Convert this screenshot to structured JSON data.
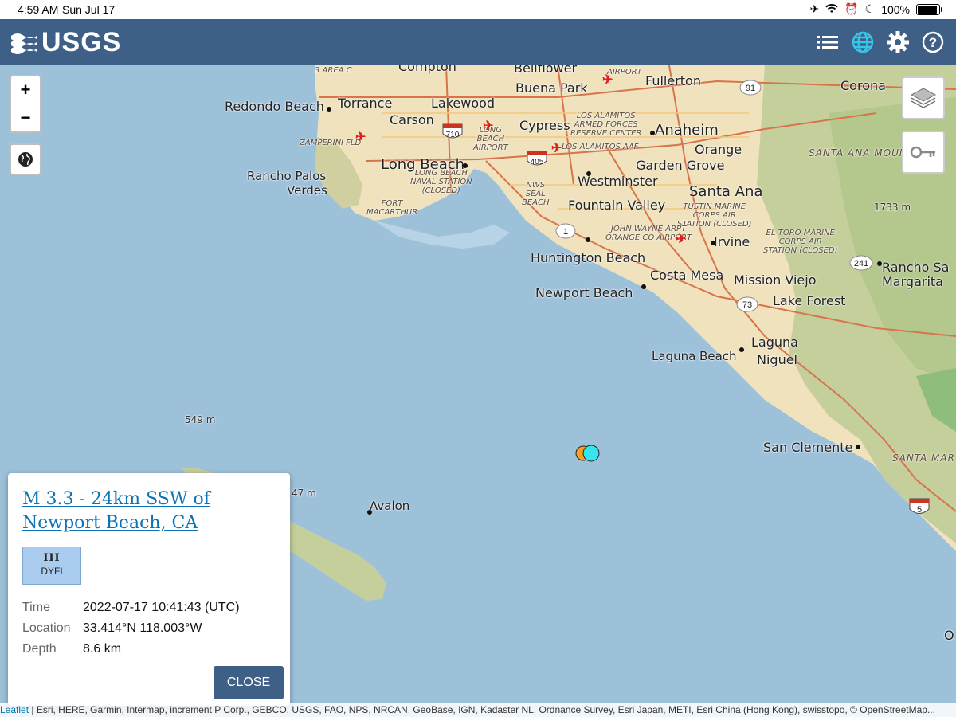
{
  "status_bar": {
    "time": "4:59 AM",
    "date": "Sun Jul 17",
    "battery": "100%",
    "battery_level": 1.0
  },
  "header": {
    "logo_text": "USGS",
    "icons": [
      "list-icon",
      "globe-icon",
      "gear-icon",
      "help-icon"
    ],
    "active_color": "#35c6e8",
    "bg_color": "#3e5f86"
  },
  "map": {
    "controls": {
      "zoom_in": "+",
      "zoom_out": "−"
    },
    "places": {
      "compton": "Compton",
      "bellflower": "Bellflower",
      "fullerton": "Fullerton",
      "corona": "Corona",
      "redondo": "Redondo Beach",
      "torrance": "Torrance",
      "lakewood": "Lakewood",
      "buena_park": "Buena Park",
      "carson": "Carson",
      "cypress": "Cypress",
      "anaheim": "Anaheim",
      "orange": "Orange",
      "long_beach": "Long Beach",
      "garden_grove": "Garden Grove",
      "westminster": "Westminster",
      "santa_ana": "Santa Ana",
      "rancho_palos": "Rancho Palos",
      "verdes": "Verdes",
      "fountain_valley": "Fountain Valley",
      "irvine": "Irvine",
      "huntington": "Huntington Beach",
      "costa_mesa": "Costa Mesa",
      "mission_viejo": "Mission Viejo",
      "newport": "Newport Beach",
      "lake_forest": "Lake Forest",
      "rancho_sm1": "Rancho Sa",
      "rancho_sm2": "Margarita",
      "laguna_beach": "Laguna Beach",
      "laguna_niguel1": "Laguna",
      "laguna_niguel2": "Niguel",
      "san_clemente": "San Clemente",
      "avalon": "Avalon",
      "zamperini": "ZAMPERINI FLD",
      "fort_macarthur": "FORT\nMACARTHUR",
      "lb_naval": "LONG BEACH\nNAVAL STATION\n(CLOSED)",
      "lb_airport": "LONG\nBEACH\nAIRPORT",
      "los_alamitos": "LOS ALAMITOS\nARMED FORCES\nRESERVE CENTER",
      "los_alamitos_aaf": "LOS ALAMITOS AAF",
      "nws_seal": "NWS\nSEAL\nBEACH",
      "tustin": "TUSTIN MARINE\nCORPS AIR\nSTATION (CLOSED)",
      "john_wayne": "JOHN WAYNE ARPT\nORANGE CO AIRPORT",
      "el_toro": "EL TORO MARINE\nCORPS AIR\nSTATION (CLOSED)",
      "santa_ana_mtn": "SANTA ANA MOUNT",
      "santa_mar": "SANTA MAR",
      "airport_top": "AIRPORT",
      "area_c": "3 AREA C",
      "elev_1733": "1733 m",
      "elev_549": "549 m",
      "elev_47": "47 m",
      "o_edge": "O"
    },
    "shields": {
      "r710": "710",
      "r405": "405",
      "r1": "1",
      "r91": "91",
      "r241": "241",
      "r73": "73",
      "r5": "5"
    },
    "event_colors": [
      "#f5a11c",
      "#35e6f0"
    ]
  },
  "popup": {
    "title": "M 3.3 - 24km SSW of Newport Beach, CA",
    "dyfi_roman": "III",
    "dyfi_label": "DYFI",
    "dyfi_color": "#aaccee",
    "rows": [
      {
        "key": "Time",
        "value": "2022-07-17 10:41:43 (UTC)"
      },
      {
        "key": "Location",
        "value": "33.414°N 118.003°W"
      },
      {
        "key": "Depth",
        "value": "8.6 km"
      }
    ],
    "close_label": "CLOSE"
  },
  "attribution": {
    "leaflet": "Leaflet",
    "text": " | Esri, HERE, Garmin, Intermap, increment P Corp., GEBCO, USGS, FAO, NPS, NRCAN, GeoBase, IGN, Kadaster NL, Ordnance Survey, Esri Japan, METI, Esri China (Hong Kong), swisstopo, © OpenStreetMap..."
  }
}
